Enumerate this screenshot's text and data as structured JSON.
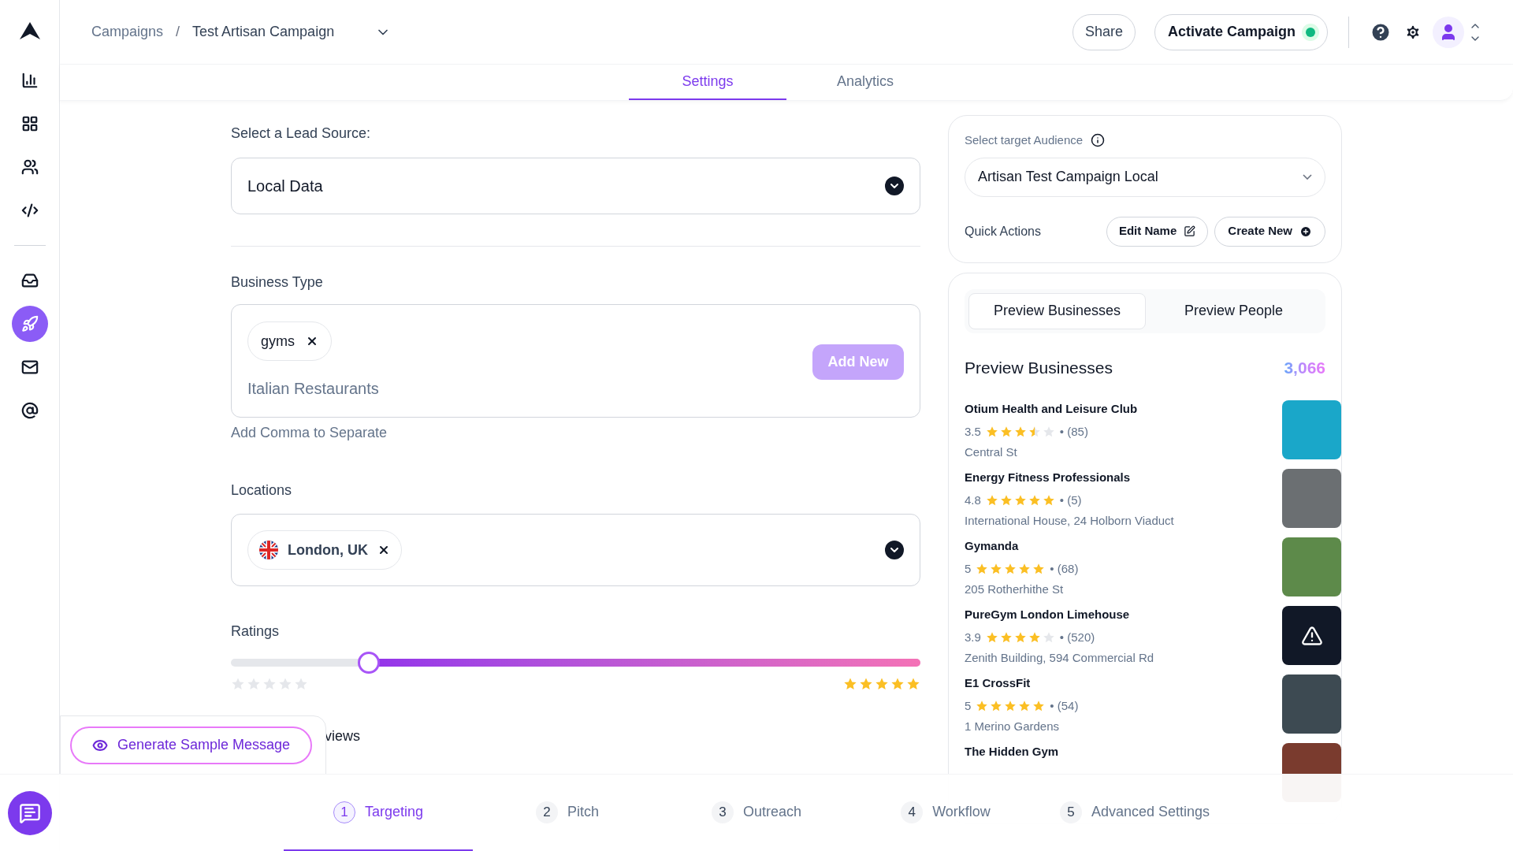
{
  "sidebar": {
    "items": [
      {
        "kind": "chart",
        "selected": false
      },
      {
        "kind": "apps",
        "selected": false
      },
      {
        "kind": "people",
        "selected": false
      },
      {
        "kind": "code",
        "selected": false
      },
      {
        "kind": "divider"
      },
      {
        "kind": "inbox",
        "selected": false
      },
      {
        "kind": "rocket",
        "selected": true
      },
      {
        "kind": "mail",
        "selected": false
      },
      {
        "kind": "at",
        "selected": false
      }
    ]
  },
  "breadcrumb": {
    "parent": "Campaigns",
    "separator": "/",
    "current": "Test Artisan Campaign"
  },
  "header": {
    "share": "Share",
    "activate": "Activate Campaign",
    "active": true
  },
  "tabs": [
    {
      "label": "Settings",
      "selected": true
    },
    {
      "label": "Analytics",
      "selected": false
    }
  ],
  "lead_source": {
    "label": "Select a Lead Source:",
    "value": "Local Data"
  },
  "business_type": {
    "label": "Business Type",
    "tags": [
      "gyms"
    ],
    "placeholder": "Italian Restaurants",
    "add_button": "Add New",
    "hint": "Add Comma to Separate"
  },
  "locations": {
    "label": "Locations",
    "tags": [
      "London, UK"
    ]
  },
  "ratings": {
    "label": "Ratings",
    "low": {
      "level": 0.2,
      "stars": 0
    },
    "high": {
      "stars": 5
    }
  },
  "reviews_label": "views",
  "generate_button": "Generate Sample Message",
  "audience": {
    "label": "Select target Audience",
    "value": "Artisan Test Campaign Local",
    "quick_actions": "Quick Actions",
    "edit": "Edit Name",
    "create": "Create New"
  },
  "preview": {
    "tabs": [
      {
        "label": "Preview Businesses",
        "selected": true
      },
      {
        "label": "Preview People",
        "selected": false
      }
    ],
    "title": "Preview Businesses",
    "count": "3,066",
    "businesses": [
      {
        "name": "Otium Health and Leisure Club",
        "rating": "3.5",
        "stars": 3.5,
        "reviews": "• (85)",
        "address": "Central St",
        "kind": "photo",
        "color": "#1aa7c9"
      },
      {
        "name": "Energy Fitness Professionals",
        "rating": "4.8",
        "stars": 5,
        "reviews": "• (5)",
        "address": "International House, 24 Holborn Viaduct",
        "kind": "photo",
        "color": "#6b6f72"
      },
      {
        "name": "Gymanda",
        "rating": "5",
        "stars": 5,
        "reviews": "• (68)",
        "address": "205 Rotherhithe St",
        "kind": "photo",
        "color": "#5d8a4a"
      },
      {
        "name": "PureGym London Limehouse",
        "rating": "3.9",
        "stars": 4,
        "reviews": "• (520)",
        "address": "Zenith Building, 594 Commercial Rd",
        "kind": "missing",
        "color": "#111827"
      },
      {
        "name": "E1 CrossFit",
        "rating": "5",
        "stars": 5,
        "reviews": "• (54)",
        "address": "1 Merino Gardens",
        "kind": "photo",
        "color": "#3d4a52"
      },
      {
        "name": "The Hidden Gym",
        "kind": "photo",
        "color": "#7a3b2e"
      }
    ]
  },
  "steps": [
    {
      "number": "1",
      "label": "Targeting",
      "selected": true
    },
    {
      "number": "2",
      "label": "Pitch",
      "selected": false
    },
    {
      "number": "3",
      "label": "Outreach",
      "selected": false
    },
    {
      "number": "4",
      "label": "Workflow",
      "selected": false
    },
    {
      "number": "5",
      "label": "Advanced Settings",
      "selected": false
    }
  ]
}
